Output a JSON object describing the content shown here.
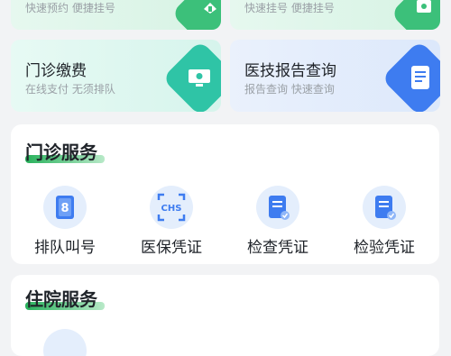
{
  "top_cards": [
    {
      "subtitle": "快速预约 便捷挂号"
    },
    {
      "subtitle": "快速挂号 便捷挂号"
    }
  ],
  "cards": [
    {
      "title": "门诊缴费",
      "subtitle": "在线支付 无须排队",
      "icon": "payment-monitor-icon",
      "color": "#2fc4a6"
    },
    {
      "title": "医技报告查询",
      "subtitle": "报告查询 快速查询",
      "icon": "report-document-icon",
      "color": "#3e7cf0"
    }
  ],
  "outpatient": {
    "title": "门诊服务",
    "items": [
      {
        "label": "排队叫号",
        "icon": "queue-number-icon"
      },
      {
        "label": "医保凭证",
        "icon": "chs-insurance-icon"
      },
      {
        "label": "检查凭证",
        "icon": "exam-voucher-icon"
      },
      {
        "label": "检验凭证",
        "icon": "lab-voucher-icon"
      }
    ]
  },
  "inpatient": {
    "title": "住院服务"
  }
}
